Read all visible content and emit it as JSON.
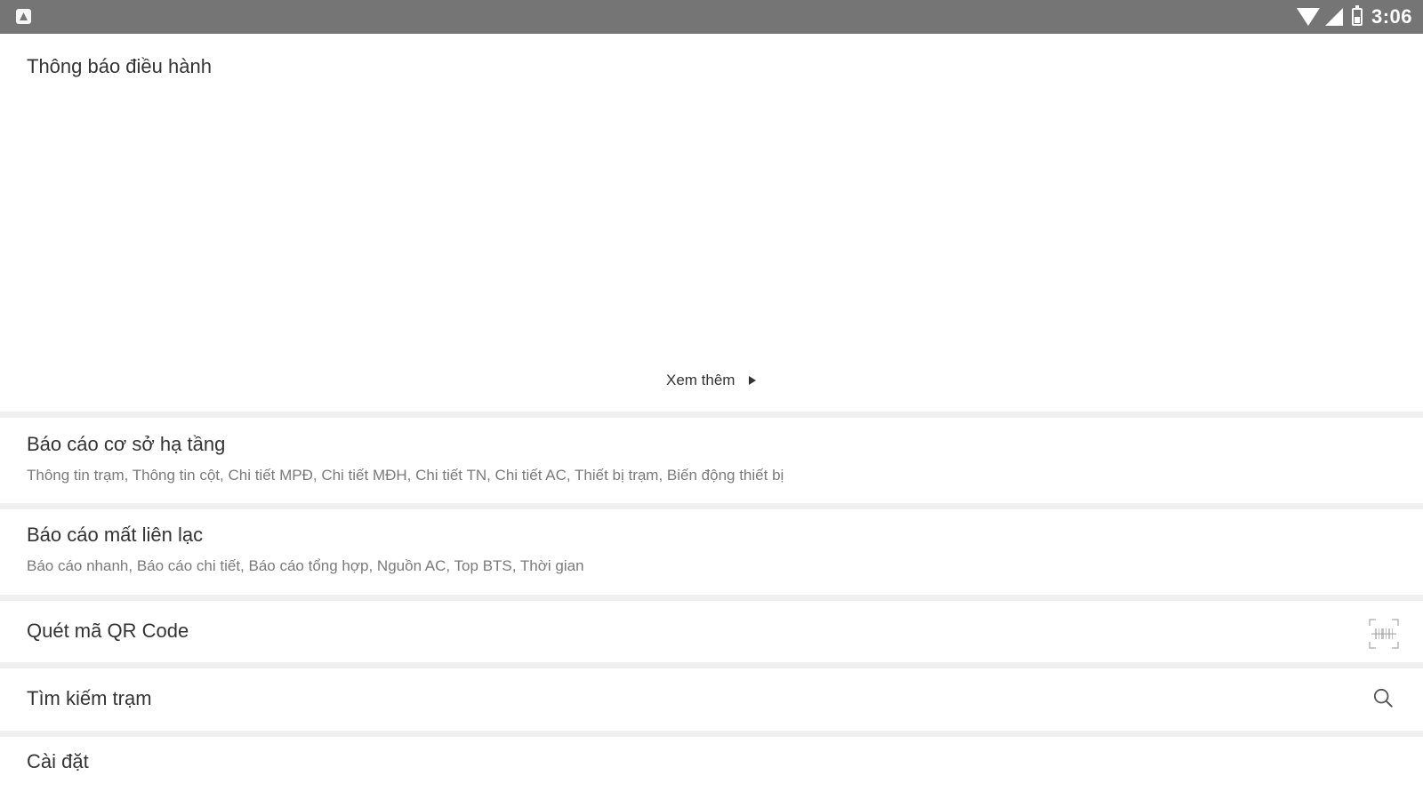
{
  "status_bar": {
    "time": "3:06",
    "icons": [
      "app-notification-icon",
      "wifi-icon",
      "cell-signal-icon",
      "battery-icon"
    ]
  },
  "notice": {
    "title": "Thông báo điều hành",
    "see_more": "Xem thêm"
  },
  "menu": {
    "infrastructure": {
      "title": "Báo cáo cơ sở hạ tầng",
      "subtitle": "Thông tin trạm, Thông tin cột, Chi tiết MPĐ, Chi tiết MĐH, Chi tiết TN, Chi tiết AC, Thiết bị trạm, Biến động thiết bị"
    },
    "lost_contact": {
      "title": "Báo cáo mất liên lạc",
      "subtitle": "Báo cáo nhanh, Báo cáo chi tiết, Báo cáo tổng hợp, Nguồn AC, Top BTS, Thời gian"
    },
    "qr_scan": {
      "title": "Quét mã QR Code",
      "icon": "qr-code-icon"
    },
    "station_search": {
      "title": "Tìm kiếm trạm",
      "icon": "search-icon"
    },
    "settings": {
      "title": "Cài đặt"
    }
  },
  "colors": {
    "status_bar": "#757575",
    "divider": "#efefef",
    "text_primary": "#333333",
    "text_secondary": "#7a7a7a"
  }
}
